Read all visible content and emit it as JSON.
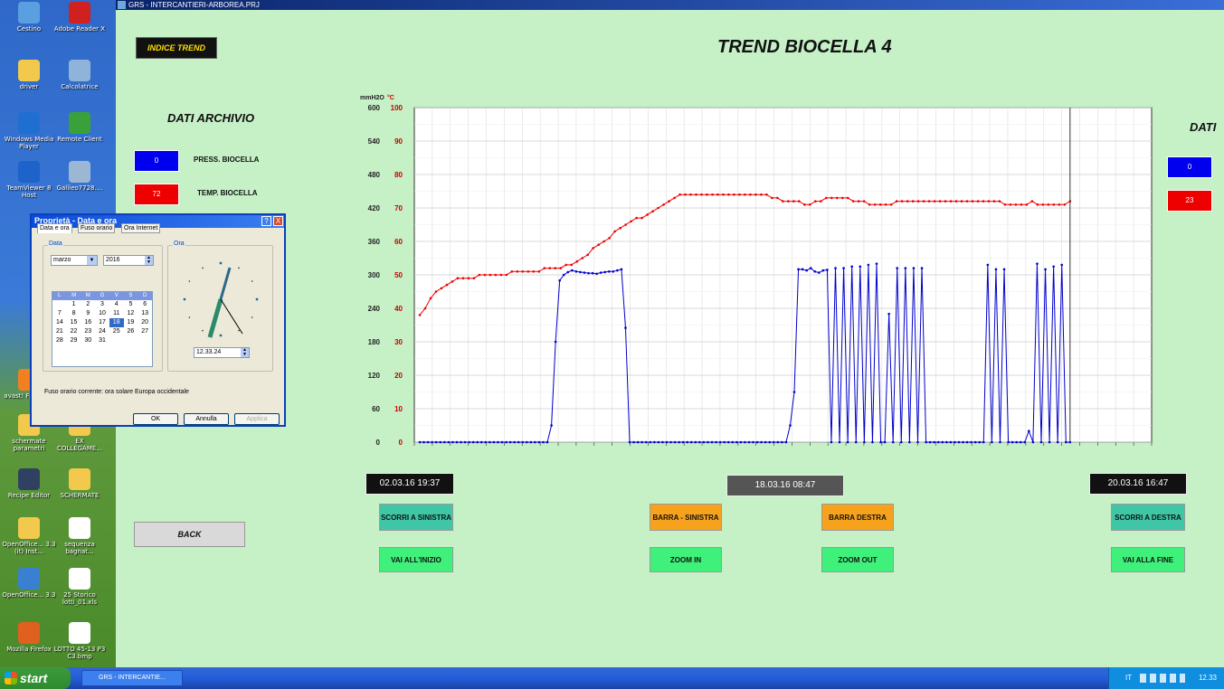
{
  "desktop": {
    "icons": [
      {
        "label": "Cestino",
        "color": "#5aa0e0"
      },
      {
        "label": "Adobe Reader X",
        "color": "#d02020"
      },
      {
        "label": "driver",
        "color": "#f2c94c"
      },
      {
        "label": "Calcolatrice",
        "color": "#8fb3d9"
      },
      {
        "label": "Windows Media Player",
        "color": "#1f6fd0"
      },
      {
        "label": "Remote Client",
        "color": "#3aa03a"
      },
      {
        "label": "TeamViewer 8 Host",
        "color": "#1d63c9"
      },
      {
        "label": "Galileo7728....",
        "color": "#9bb7d4"
      },
      {
        "label": "avast! Free Anti",
        "color": "#f08020"
      },
      {
        "label": "schermate parametri",
        "color": "#f2c94c"
      },
      {
        "label": "EX COLLEGAME...",
        "color": "#f2c94c"
      },
      {
        "label": "Recipe Editor",
        "color": "#304060"
      },
      {
        "label": "SCHERMATE",
        "color": "#f2c94c"
      },
      {
        "label": "OpenOffice... 3.3 (it) Inst...",
        "color": "#f2c94c"
      },
      {
        "label": "sequenza bagnat...",
        "color": "#ffffff"
      },
      {
        "label": "OpenOffice... 3.3",
        "color": "#3a80d0"
      },
      {
        "label": "25 Storico lotti_01.xls",
        "color": "#ffffff"
      },
      {
        "label": "Mozilla Firefox",
        "color": "#e06020"
      },
      {
        "label": "LOTTO 45-13 P3 C3.bmp",
        "color": "#ffffff"
      }
    ]
  },
  "window": {
    "title": "GRS - INTERCANTIERI-ARBOREA.PRJ"
  },
  "app": {
    "indice_trend": "INDICE TREND",
    "title": "TREND BIOCELLA 4",
    "dati_archivio": "DATI ARCHIVIO",
    "dati_right": "DATI",
    "press": {
      "value": "0",
      "label": "PRESS. BIOCELLA",
      "color": "#0000ee"
    },
    "temp": {
      "value": "72",
      "label": "TEMP. BIOCELLA",
      "color": "#ee0000"
    },
    "right_press": "0",
    "right_temp": "23",
    "back": "BACK",
    "date_left": "02.03.16 19:37",
    "date_center": "18.03.16 08:47",
    "date_right": "20.03.16 16:47",
    "buttons": {
      "scorri_sinistra": "SCORRI A SINISTRA",
      "barra_sinistra": "BARRA - SINISTRA",
      "barra_destra": "BARRA DESTRA",
      "scorri_destra": "SCORRI A DESTRA",
      "vai_inizio": "VAI ALL'INIZIO",
      "zoom_in": "ZOOM IN",
      "zoom_out": "ZOOM OUT",
      "vai_fine": "VAI ALLA FINE"
    }
  },
  "chart_data": {
    "type": "line",
    "unit_left": "mmH2O",
    "unit_right": "°C",
    "y_left_ticks": [
      "600",
      "540",
      "480",
      "420",
      "360",
      "300",
      "240",
      "180",
      "120",
      "60",
      "0"
    ],
    "y_right_ticks": [
      "100",
      "90",
      "80",
      "70",
      "60",
      "50",
      "40",
      "30",
      "20",
      "10",
      "0"
    ],
    "ylim_left": [
      0,
      600
    ],
    "ylim_right": [
      0,
      100
    ],
    "grid": true,
    "series": [
      {
        "color": "#ee0000",
        "axis": "right",
        "values": [
          38,
          40,
          43,
          45,
          46,
          47,
          48,
          49,
          49,
          49,
          49,
          50,
          50,
          50,
          50,
          50,
          50,
          51,
          51,
          51,
          51,
          51,
          51,
          52,
          52,
          52,
          52,
          53,
          53,
          54,
          55,
          56,
          58,
          59,
          60,
          61,
          63,
          64,
          65,
          66,
          67,
          67,
          68,
          69,
          70,
          71,
          72,
          73,
          74,
          74,
          74,
          74,
          74,
          74,
          74,
          74,
          74,
          74,
          74,
          74,
          74,
          74,
          74,
          74,
          74,
          73,
          73,
          72,
          72,
          72,
          72,
          71,
          71,
          72,
          72,
          73,
          73,
          73,
          73,
          73,
          72,
          72,
          72,
          71,
          71,
          71,
          71,
          71,
          72,
          72,
          72,
          72,
          72,
          72,
          72,
          72,
          72,
          72,
          72,
          72,
          72,
          72,
          72,
          72,
          72,
          72,
          72,
          72,
          71,
          71,
          71,
          71,
          71,
          72,
          71,
          71,
          71,
          71,
          71,
          71,
          72
        ]
      },
      {
        "color": "#0000cc",
        "axis": "left",
        "values": [
          0,
          0,
          0,
          0,
          0,
          0,
          0,
          0,
          0,
          0,
          0,
          0,
          0,
          0,
          0,
          0,
          0,
          0,
          0,
          0,
          0,
          0,
          0,
          0,
          0,
          0,
          0,
          0,
          0,
          0,
          0,
          0,
          30,
          180,
          290,
          300,
          305,
          308,
          306,
          305,
          304,
          303,
          303,
          302,
          304,
          305,
          306,
          306,
          308,
          310,
          205,
          0,
          0,
          0,
          0,
          0,
          0,
          0,
          0,
          0,
          0,
          0,
          0,
          0,
          0,
          0,
          0,
          0,
          0,
          0,
          0,
          0,
          0,
          0,
          0,
          0,
          0,
          0,
          0,
          0,
          0,
          0,
          0,
          0,
          0,
          0,
          0,
          0,
          0,
          0,
          30,
          90,
          310,
          310,
          308,
          312,
          306,
          304,
          308,
          309,
          0,
          312,
          0,
          312,
          0,
          315,
          0,
          315,
          0,
          318,
          0,
          320,
          0,
          0,
          230,
          0,
          312,
          0,
          312,
          0,
          312,
          0,
          312,
          0,
          0,
          0,
          0,
          0,
          0,
          0,
          0,
          0,
          0,
          0,
          0,
          0,
          0,
          0,
          318,
          0,
          310,
          0,
          310,
          0,
          0,
          0,
          0,
          0,
          20,
          0,
          320,
          0,
          310,
          0,
          315,
          0,
          318,
          0,
          0
        ]
      }
    ],
    "cursor_index": 0.88
  },
  "dialog": {
    "title": "Proprietà - Data e ora",
    "tabs": [
      "Data e ora",
      "Fuso orario",
      "Ora Internet"
    ],
    "group_data": "Data",
    "group_ora": "Ora",
    "month": "marzo",
    "year": "2016",
    "weekdays": [
      "L",
      "M",
      "M",
      "G",
      "V",
      "S",
      "D"
    ],
    "days": [
      "",
      "1",
      "2",
      "3",
      "4",
      "5",
      "6",
      "7",
      "8",
      "9",
      "10",
      "11",
      "12",
      "13",
      "14",
      "15",
      "16",
      "17",
      "18",
      "19",
      "20",
      "21",
      "22",
      "23",
      "24",
      "25",
      "26",
      "27",
      "28",
      "29",
      "30",
      "31",
      "",
      "",
      ""
    ],
    "selected_day": "18",
    "time": "12.33.24",
    "timezone": "Fuso orario corrente: ora solare Europa occidentale",
    "ok": "OK",
    "cancel": "Annulla",
    "apply": "Applica",
    "help": "?",
    "close": "X"
  },
  "taskbar": {
    "start": "start",
    "task": "GRS - INTERCANTIE...",
    "lang": "IT",
    "clock": "12.33"
  }
}
